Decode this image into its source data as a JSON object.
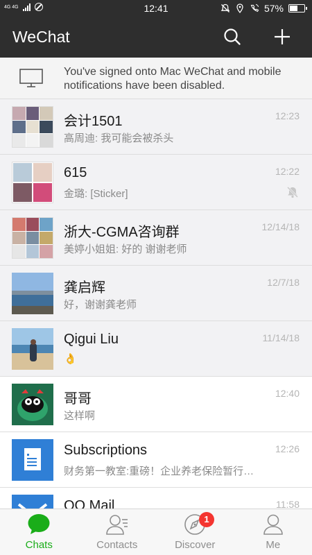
{
  "status_bar": {
    "network": "4G 4G",
    "time": "12:41",
    "battery": "57%",
    "battery_level": 0.57
  },
  "header": {
    "title": "WeChat"
  },
  "banner": {
    "message": "You've signed onto Mac WeChat and mobile notifications have been disabled."
  },
  "chats": [
    {
      "name": "会计1501",
      "preview": "高周迪: 我可能会被杀头",
      "time": "12:23",
      "muted": false,
      "pinned": true
    },
    {
      "name": "615",
      "preview": "金璐: [Sticker]",
      "time": "12:22",
      "muted": true,
      "pinned": true
    },
    {
      "name": "浙大-CGMA咨询群",
      "preview": "美婷小姐姐: 好的 谢谢老师",
      "time": "12/14/18",
      "muted": false,
      "pinned": true
    },
    {
      "name": "龚启辉",
      "preview": "好，谢谢龚老师",
      "time": "12/7/18",
      "muted": false,
      "pinned": true
    },
    {
      "name": "Qigui Liu",
      "preview": "👌",
      "time": "11/14/18",
      "muted": false,
      "pinned": true
    },
    {
      "name": "哥哥",
      "preview": "这样啊",
      "time": "12:40",
      "muted": false,
      "pinned": false
    },
    {
      "name": "Subscriptions",
      "preview": "财务第一教室:重磅！企业养老保险暂行办法",
      "time": "12:26",
      "muted": false,
      "pinned": false
    },
    {
      "name": "QQ Mail",
      "preview": "",
      "time": "11:58",
      "muted": false,
      "pinned": false
    }
  ],
  "tabs": [
    {
      "label": "Chats",
      "active": true
    },
    {
      "label": "Contacts",
      "active": false
    },
    {
      "label": "Discover",
      "active": false,
      "badge": "1"
    },
    {
      "label": "Me",
      "active": false
    }
  ],
  "colors": {
    "bar_bg": "#2e2e2e",
    "accent_green": "#1aad19",
    "badge_red": "#f43530"
  }
}
